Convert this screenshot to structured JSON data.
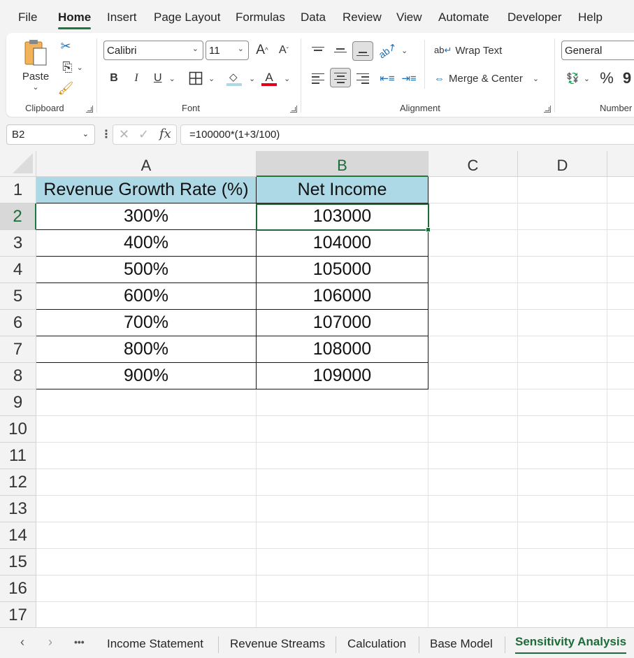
{
  "menu": {
    "tabs": [
      "File",
      "Home",
      "Insert",
      "Page Layout",
      "Formulas",
      "Data",
      "Review",
      "View",
      "Automate",
      "Developer",
      "Help"
    ],
    "active": "Home"
  },
  "ribbon": {
    "clipboard": {
      "paste_label": "Paste",
      "group_label": "Clipboard"
    },
    "font": {
      "font_name": "Calibri",
      "font_size": "11",
      "bold": "B",
      "italic": "I",
      "underline": "U",
      "font_color_glyph": "A",
      "grow_glyph": "A",
      "shrink_glyph": "A",
      "group_label": "Font"
    },
    "alignment": {
      "wrap_label": "Wrap Text",
      "merge_label": "Merge & Center",
      "group_label": "Alignment"
    },
    "number": {
      "format": "General",
      "percent": "%",
      "comma": "9",
      "group_label": "Number"
    }
  },
  "formula_bar": {
    "name_box": "B2",
    "formula": "=100000*(1+3/100)",
    "fx": "fx"
  },
  "grid": {
    "columns": [
      "A",
      "B",
      "C",
      "D"
    ],
    "rows": [
      "1",
      "2",
      "3",
      "4",
      "5",
      "6",
      "7",
      "8",
      "9",
      "10",
      "11",
      "12",
      "13",
      "14",
      "15",
      "16",
      "17"
    ],
    "header": {
      "a": "Revenue Growth Rate (%)",
      "b": "Net Income"
    },
    "data": [
      {
        "a": "300%",
        "b": "103000"
      },
      {
        "a": "400%",
        "b": "104000"
      },
      {
        "a": "500%",
        "b": "105000"
      },
      {
        "a": "600%",
        "b": "106000"
      },
      {
        "a": "700%",
        "b": "107000"
      },
      {
        "a": "800%",
        "b": "108000"
      },
      {
        "a": "900%",
        "b": "109000"
      }
    ],
    "selected_cell": "B2"
  },
  "sheets": {
    "tabs": [
      "Income Statement",
      "Revenue Streams",
      "Calculation",
      "Base Model",
      "Sensitivity Analysis"
    ],
    "active": "Sensitivity Analysis",
    "more": "•••"
  },
  "colors": {
    "accent": "#1d6b38",
    "header_fill": "#add8e6"
  }
}
